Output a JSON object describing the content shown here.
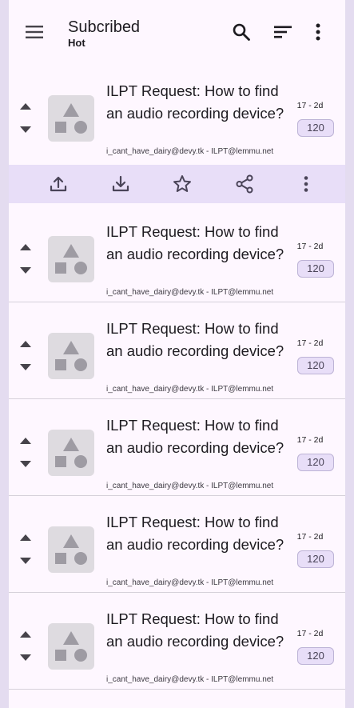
{
  "app_bar": {
    "title": "Subcribed",
    "subtitle": "Hot",
    "menu_icon": "menu-icon",
    "search_icon": "search-icon",
    "sort_icon": "sort-icon",
    "more_icon": "more-vert-icon"
  },
  "post_actions": {
    "icons": [
      "upload-icon",
      "download-icon",
      "star-icon",
      "share-icon",
      "more-vert-icon"
    ]
  },
  "posts": [
    {
      "title": "ILPT Request: How to find an audio recording device?",
      "meta": "i_cant_have_dairy@devy.tk - ILPT@lemmu.net",
      "stat": "17 - 2d",
      "score": "120"
    },
    {
      "title": "ILPT Request: How to find an audio recording device?",
      "meta": "i_cant_have_dairy@devy.tk - ILPT@lemmu.net",
      "stat": "17 - 2d",
      "score": "120"
    },
    {
      "title": "ILPT Request: How to find an audio recording device?",
      "meta": "i_cant_have_dairy@devy.tk - ILPT@lemmu.net",
      "stat": "17 - 2d",
      "score": "120"
    },
    {
      "title": "ILPT Request: How to find an audio recording device?",
      "meta": "i_cant_have_dairy@devy.tk - ILPT@lemmu.net",
      "stat": "17 - 2d",
      "score": "120"
    },
    {
      "title": "ILPT Request: How to find an audio recording device?",
      "meta": "i_cant_have_dairy@devy.tk - ILPT@lemmu.net",
      "stat": "17 - 2d",
      "score": "120"
    },
    {
      "title": "ILPT Request: How to find an audio recording device?",
      "meta": "i_cant_have_dairy@devy.tk - ILPT@lemmu.net",
      "stat": "17 - 2d",
      "score": "120"
    }
  ],
  "colors": {
    "surface": "#fef7ff",
    "frame": "#e4dcf0",
    "action_bar": "#e8def8",
    "score_chip": "#e8def8",
    "thumbnail": "#dedbe0",
    "thumbnail_shapes": "#9e9ba3"
  }
}
